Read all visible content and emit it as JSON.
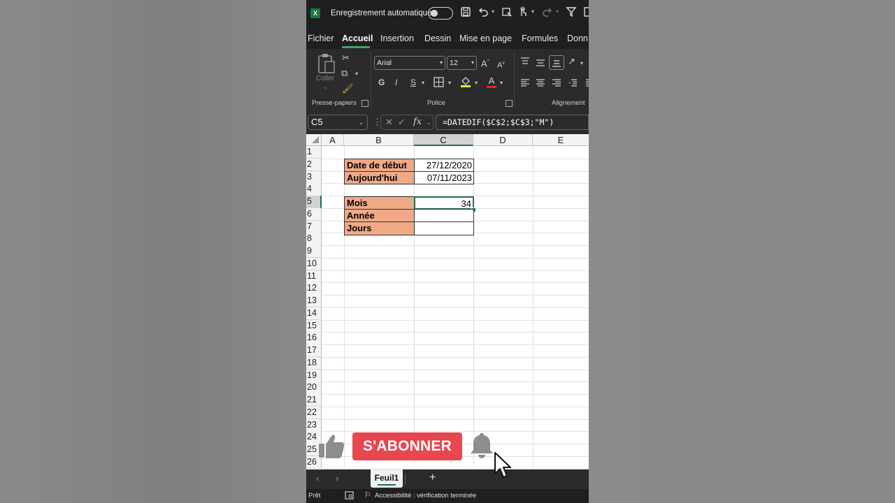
{
  "titlebar": {
    "app_icon": "excel-logo",
    "app_icon_letter": "X",
    "autosave_label": "Enregistrement automatique",
    "autosave_state": "off",
    "icons": [
      "save-icon",
      "undo-icon",
      "format-painter-icon",
      "touch-icon",
      "redo-icon",
      "filter-icon"
    ]
  },
  "tabs": [
    "Fichier",
    "Accueil",
    "Insertion",
    "Dessin",
    "Mise en page",
    "Formules",
    "Donn"
  ],
  "active_tab": "Accueil",
  "ribbon": {
    "clipboard": {
      "paste_label": "Coller",
      "group_label": "Presse-papiers"
    },
    "font": {
      "font_name": "Arial",
      "font_size": "12",
      "bold": "G",
      "italic": "I",
      "underline": "S",
      "grow": "A",
      "shrink": "A",
      "font_color": "A",
      "group_label": "Police"
    },
    "alignment": {
      "group_label": "Alignement"
    }
  },
  "formula_bar": {
    "name_box": "C5",
    "fx_label": "fx",
    "formula": "=DATEDIF($C$2;$C$3;\"M\")"
  },
  "grid": {
    "columns": [
      "A",
      "B",
      "C",
      "D",
      "E"
    ],
    "selected_column": "C",
    "rows": [
      "1",
      "2",
      "3",
      "4",
      "5",
      "6",
      "7",
      "8",
      "9",
      "10",
      "11",
      "12",
      "13",
      "14",
      "15",
      "16",
      "17",
      "18",
      "19",
      "20",
      "21",
      "22",
      "23",
      "24",
      "25",
      "26"
    ],
    "selected_row": "5",
    "cells": {
      "B2": "Date de début",
      "C2": "27/12/2020",
      "B3": "Aujourd'hui",
      "C3": "07/11/2023",
      "B5": "Mois",
      "C5": "34",
      "B6": "Année",
      "C6": "",
      "B7": "Jours",
      "C7": ""
    },
    "label_fill_color": "#f0a987",
    "accent_color": "#217346"
  },
  "sheet_tabs": {
    "active": "Feuil1",
    "add_label": "+"
  },
  "status_bar": {
    "ready": "Prêt",
    "accessibility": "Accessibilité : vérification terminée"
  },
  "overlay": {
    "subscribe_label": "S'ABONNER",
    "subscribe_color": "#e8474f",
    "icons": [
      "thumbs-up-icon",
      "bell-icon",
      "mouse-cursor-icon"
    ]
  }
}
